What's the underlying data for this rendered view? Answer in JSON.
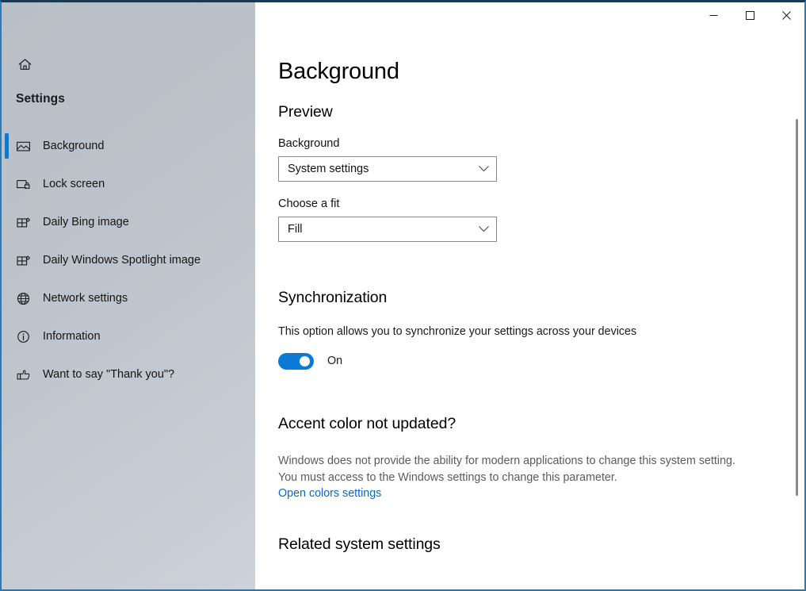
{
  "window": {
    "controls": {
      "minimize_label": "Minimize",
      "maximize_label": "Maximize",
      "close_label": "Close"
    },
    "accent_color": "#0a7ad6",
    "border_color": "#2a7cb8",
    "titlebar_top_color": "#1b3a52"
  },
  "sidebar": {
    "home_label": "Home",
    "title": "Settings",
    "items": [
      {
        "label": "Background",
        "icon": "picture-icon",
        "selected": true
      },
      {
        "label": "Lock screen",
        "icon": "lock-screen-icon",
        "selected": false
      },
      {
        "label": "Daily Bing image",
        "icon": "daily-image-icon",
        "selected": false
      },
      {
        "label": "Daily Windows Spotlight image",
        "icon": "daily-image-icon",
        "selected": false
      },
      {
        "label": "Network settings",
        "icon": "globe-icon",
        "selected": false
      },
      {
        "label": "Information",
        "icon": "info-icon",
        "selected": false
      },
      {
        "label": "Want to say \"Thank you\"?",
        "icon": "thumbs-up-icon",
        "selected": false
      }
    ]
  },
  "main": {
    "page_title": "Background",
    "preview": {
      "heading": "Preview",
      "background_label": "Background",
      "background_value": "System settings",
      "fit_label": "Choose a fit",
      "fit_value": "Fill"
    },
    "synchronization": {
      "heading": "Synchronization",
      "description": "This option allows you to synchronize your settings across your devices",
      "toggle_state": "On",
      "toggle_on": true
    },
    "accent": {
      "heading": "Accent color not updated?",
      "description_line1": "Windows does not provide the ability for modern applications to change this system setting.",
      "description_line2": "You must access to the Windows settings to change this parameter.",
      "link_label": "Open colors settings"
    },
    "related": {
      "heading": "Related system settings"
    }
  },
  "scrollbar": {
    "thumb_present": true
  }
}
